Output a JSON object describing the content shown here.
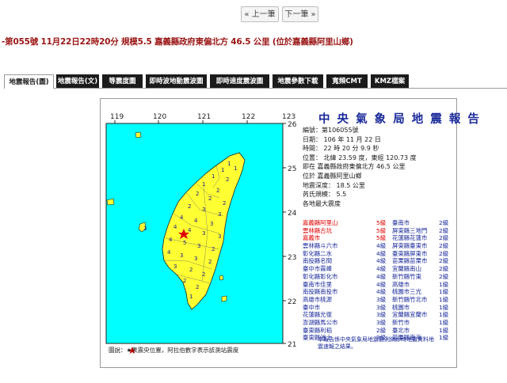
{
  "nav": {
    "prev_label": "« 上一筆",
    "next_label": "下一筆 »"
  },
  "headline": "-第055號 11月22日22時20分 規模5.5 嘉義縣政府東偏北方 46.5 公里 (位於嘉義縣阿里山鄉)",
  "tabs": [
    {
      "label": "地震報告(圖)",
      "active": true
    },
    {
      "label": "地震報告(文)",
      "active": false
    },
    {
      "label": "等震度圖",
      "active": false
    },
    {
      "label": "即時波地動震波圖",
      "active": false
    },
    {
      "label": "即時速度震波圖",
      "active": false
    },
    {
      "label": "地震參數下載",
      "active": false
    },
    {
      "label": "寬頻CMT",
      "active": false
    },
    {
      "label": "KMZ檔案",
      "active": false
    }
  ],
  "report": {
    "title": "中 央 氣 象 局 地 震 報 告",
    "lines": [
      "編號：第106055號",
      "日期： 106 年 11 月 22 日",
      "時間： 22 時 20 分 9.9 秒",
      "位置： 北緯 23.59 度，東經 120.73 度",
      "即在 嘉義縣政府東偏北方 46.5 公里",
      "位於 嘉義縣阿里山鄉",
      "地震深度： 18.5 公里",
      "芮氏規模： 5.5",
      "各地最大震度"
    ],
    "intensity": [
      {
        "n1": "嘉義縣阿里山",
        "l1": "5級",
        "n2": "臺南市",
        "l2": "2級",
        "red": true
      },
      {
        "n1": "雲林縣古坑",
        "l1": "5級",
        "n2": "屏東縣三地門",
        "l2": "2級",
        "red": true
      },
      {
        "n1": "嘉義市",
        "l1": "5級",
        "n2": "花蓮縣花蓮市",
        "l2": "2級",
        "red": true
      },
      {
        "n1": "雲林縣斗六市",
        "l1": "4級",
        "n2": "屏東縣臺東市",
        "l2": "2級",
        "red": false
      },
      {
        "n1": "彰化縣二水",
        "l1": "4級",
        "n2": "臺東縣屏東市",
        "l2": "2級",
        "red": false
      },
      {
        "n1": "南投縣名間",
        "l1": "4級",
        "n2": "苗栗縣苗栗市",
        "l2": "2級",
        "red": false
      },
      {
        "n1": "臺中市霧峰",
        "l1": "4級",
        "n2": "宜蘭縣南山",
        "l2": "2級",
        "red": false
      },
      {
        "n1": "彰化縣彰化市",
        "l1": "4級",
        "n2": "新竹縣竹東",
        "l2": "2級",
        "red": false
      },
      {
        "n1": "臺南市佳里",
        "l1": "4級",
        "n2": "高雄市",
        "l2": "1級",
        "red": false
      },
      {
        "n1": "南投縣南投市",
        "l1": "4級",
        "n2": "桃園市三光",
        "l2": "1級",
        "red": false
      },
      {
        "n1": "高雄市桃源",
        "l1": "3級",
        "n2": "新竹縣竹北市",
        "l2": "1級",
        "red": false
      },
      {
        "n1": "臺中市",
        "l1": "3級",
        "n2": "桃園市",
        "l2": "1級",
        "red": false
      },
      {
        "n1": "花蓮縣光復",
        "l1": "3級",
        "n2": "宜蘭縣宜蘭市",
        "l2": "1級",
        "red": false
      },
      {
        "n1": "澎湖縣馬公市",
        "l1": "3級",
        "n2": "新竹市",
        "l2": "1級",
        "red": false
      },
      {
        "n1": "臺東縣利稻",
        "l1": "2級",
        "n2": "臺北市",
        "l2": "1級",
        "red": false
      },
      {
        "n1": "臺東縣池上",
        "l1": "2級",
        "n2": "苗栗縣南海",
        "l2": "1級",
        "red": false
      }
    ],
    "note": "本報告係中央氣象局地震觀測網即時地震資料地震速報之結果。",
    "legend": "圖說：★表震央位置，阿拉伯數字表示該測站震度"
  },
  "map": {
    "lon_labels": [
      "119",
      "120",
      "121",
      "122",
      "123"
    ],
    "lat_labels": [
      "26",
      "25",
      "24",
      "23",
      "22",
      "21"
    ],
    "colors": {
      "sea": "#00ffff",
      "land": "#ffff33",
      "outline": "#222222"
    },
    "epicenter_icon": "red-star-icon"
  }
}
